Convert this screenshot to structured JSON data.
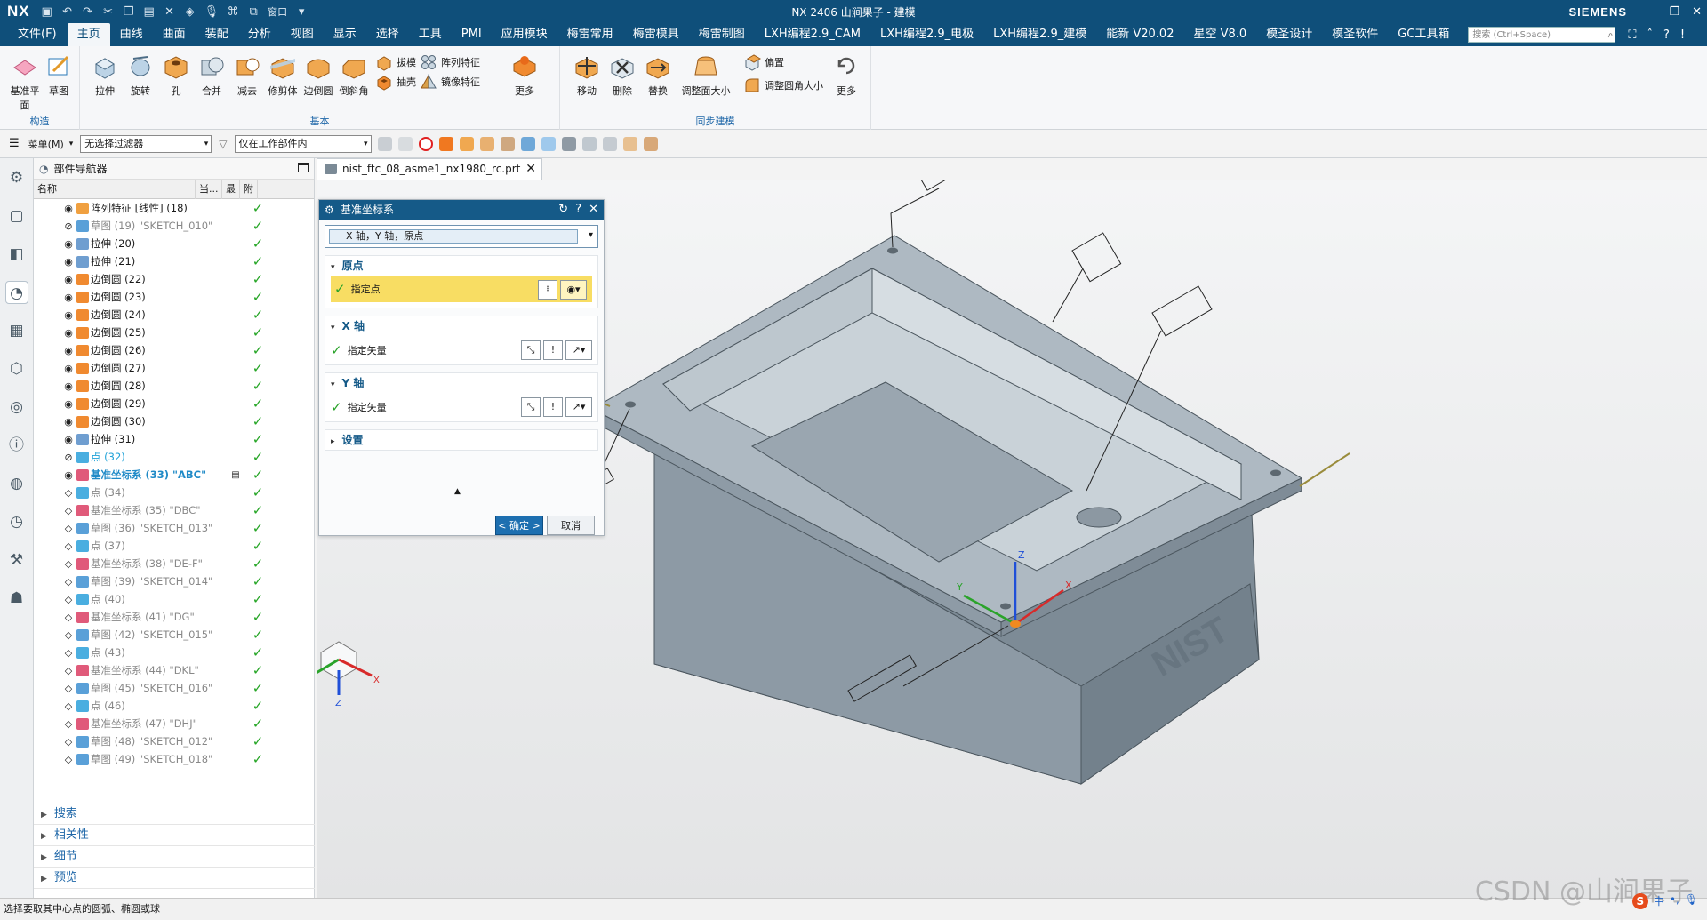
{
  "titlebar": {
    "logo": "NX",
    "window_menu": "窗口",
    "title": "NX 2406 山涧果子 - 建模",
    "brand": "SIEMENS"
  },
  "menubar": {
    "items": [
      "文件(F)",
      "主页",
      "曲线",
      "曲面",
      "装配",
      "分析",
      "视图",
      "显示",
      "选择",
      "工具",
      "PMI",
      "应用模块",
      "梅雷常用",
      "梅雷模具",
      "梅雷制图",
      "LXH编程2.9_CAM",
      "LXH编程2.9_电极",
      "LXH编程2.9_建模",
      "能新 V20.02",
      "星空 V8.0",
      "模圣设计",
      "模圣软件",
      "GC工具箱"
    ],
    "active_index": 1,
    "search_placeholder": "搜索 (Ctrl+Space)"
  },
  "ribbon": {
    "groups": [
      {
        "label": "构造"
      },
      {
        "label": "基本"
      },
      {
        "label": "同步建模"
      }
    ],
    "construct": [
      "基准平面",
      "草图"
    ],
    "basic": [
      "拉伸",
      "旋转",
      "孔",
      "合并",
      "减去",
      "修剪体",
      "边倒圆",
      "倒斜角"
    ],
    "basic_small": [
      "拔模",
      "阵列特征",
      "抽壳",
      "镜像特征"
    ],
    "basic_more": "更多",
    "sync": [
      "移动",
      "删除",
      "替换",
      "调整面大小"
    ],
    "sync_small": [
      "偏置",
      "调整圆角大小"
    ],
    "sync_more": "更多"
  },
  "toolbar2": {
    "menu": "菜单(M)",
    "filter": "无选择过滤器",
    "scope": "仅在工作部件内"
  },
  "navigator": {
    "title": "部件导航器",
    "columns": [
      "名称",
      "当...",
      "最",
      "附"
    ],
    "rows": [
      {
        "label": "阵列特征 [线性] (18)",
        "eye": "◉",
        "kind": "pattern",
        "style": "",
        "cur": ""
      },
      {
        "label": "草图 (19) \"SKETCH_010\"",
        "eye": "⊘",
        "kind": "sketch",
        "style": "dim",
        "cur": ""
      },
      {
        "label": "拉伸 (20)",
        "eye": "◉",
        "kind": "extrude",
        "style": "",
        "cur": ""
      },
      {
        "label": "拉伸 (21)",
        "eye": "◉",
        "kind": "extrude",
        "style": "",
        "cur": ""
      },
      {
        "label": "边倒圆 (22)",
        "eye": "◉",
        "kind": "blend",
        "style": "",
        "cur": ""
      },
      {
        "label": "边倒圆 (23)",
        "eye": "◉",
        "kind": "blend",
        "style": "",
        "cur": ""
      },
      {
        "label": "边倒圆 (24)",
        "eye": "◉",
        "kind": "blend",
        "style": "",
        "cur": ""
      },
      {
        "label": "边倒圆 (25)",
        "eye": "◉",
        "kind": "blend",
        "style": "",
        "cur": ""
      },
      {
        "label": "边倒圆 (26)",
        "eye": "◉",
        "kind": "blend",
        "style": "",
        "cur": ""
      },
      {
        "label": "边倒圆 (27)",
        "eye": "◉",
        "kind": "blend",
        "style": "",
        "cur": ""
      },
      {
        "label": "边倒圆 (28)",
        "eye": "◉",
        "kind": "blend",
        "style": "",
        "cur": ""
      },
      {
        "label": "边倒圆 (29)",
        "eye": "◉",
        "kind": "blend",
        "style": "",
        "cur": ""
      },
      {
        "label": "边倒圆 (30)",
        "eye": "◉",
        "kind": "blend",
        "style": "",
        "cur": ""
      },
      {
        "label": "拉伸 (31)",
        "eye": "◉",
        "kind": "extrude",
        "style": "",
        "cur": ""
      },
      {
        "label": "点 (32)",
        "eye": "⊘",
        "kind": "point",
        "style": "cyan",
        "cur": ""
      },
      {
        "label": "基准坐标系 (33) \"ABC\"",
        "eye": "◉",
        "kind": "csys",
        "style": "hl",
        "cur": "▤"
      },
      {
        "label": "点 (34)",
        "eye": "◇",
        "kind": "point",
        "style": "dim",
        "cur": ""
      },
      {
        "label": "基准坐标系 (35) \"DBC\"",
        "eye": "◇",
        "kind": "csys",
        "style": "dim",
        "cur": ""
      },
      {
        "label": "草图 (36) \"SKETCH_013\"",
        "eye": "◇",
        "kind": "sketch",
        "style": "dim",
        "cur": ""
      },
      {
        "label": "点 (37)",
        "eye": "◇",
        "kind": "point",
        "style": "dim",
        "cur": ""
      },
      {
        "label": "基准坐标系 (38) \"DE-F\"",
        "eye": "◇",
        "kind": "csys",
        "style": "dim",
        "cur": ""
      },
      {
        "label": "草图 (39) \"SKETCH_014\"",
        "eye": "◇",
        "kind": "sketch",
        "style": "dim",
        "cur": ""
      },
      {
        "label": "点 (40)",
        "eye": "◇",
        "kind": "point",
        "style": "dim",
        "cur": ""
      },
      {
        "label": "基准坐标系 (41) \"DG\"",
        "eye": "◇",
        "kind": "csys",
        "style": "dim",
        "cur": ""
      },
      {
        "label": "草图 (42) \"SKETCH_015\"",
        "eye": "◇",
        "kind": "sketch",
        "style": "dim",
        "cur": ""
      },
      {
        "label": "点 (43)",
        "eye": "◇",
        "kind": "point",
        "style": "dim",
        "cur": ""
      },
      {
        "label": "基准坐标系 (44) \"DKL\"",
        "eye": "◇",
        "kind": "csys",
        "style": "dim",
        "cur": ""
      },
      {
        "label": "草图 (45) \"SKETCH_016\"",
        "eye": "◇",
        "kind": "sketch",
        "style": "dim",
        "cur": ""
      },
      {
        "label": "点 (46)",
        "eye": "◇",
        "kind": "point",
        "style": "dim",
        "cur": ""
      },
      {
        "label": "基准坐标系 (47) \"DHJ\"",
        "eye": "◇",
        "kind": "csys",
        "style": "dim",
        "cur": ""
      },
      {
        "label": "草图 (48) \"SKETCH_012\"",
        "eye": "◇",
        "kind": "sketch",
        "style": "dim",
        "cur": ""
      },
      {
        "label": "草图 (49) \"SKETCH_018\"",
        "eye": "◇",
        "kind": "sketch",
        "style": "dim",
        "cur": ""
      }
    ],
    "sections": [
      "搜索",
      "相关性",
      "细节",
      "预览"
    ]
  },
  "doc_tab": "nist_ftc_08_asme1_nx1980_rc.prt",
  "dialog": {
    "title": "基准坐标系",
    "type": "X 轴，Y 轴，原点",
    "sections": [
      {
        "title": "原点",
        "row": "指定点"
      },
      {
        "title": "X 轴",
        "row": "指定矢量"
      },
      {
        "title": "Y 轴",
        "row": "指定矢量"
      },
      {
        "title": "设置"
      }
    ],
    "ok": "< 确定 >",
    "cancel": "取消"
  },
  "triad": {
    "x": "X",
    "y": "Y",
    "z": "Z"
  },
  "status": "选择要取其中心点的圆弧、椭圆或球",
  "watermark": "CSDN @山涧果子",
  "ime": "中"
}
